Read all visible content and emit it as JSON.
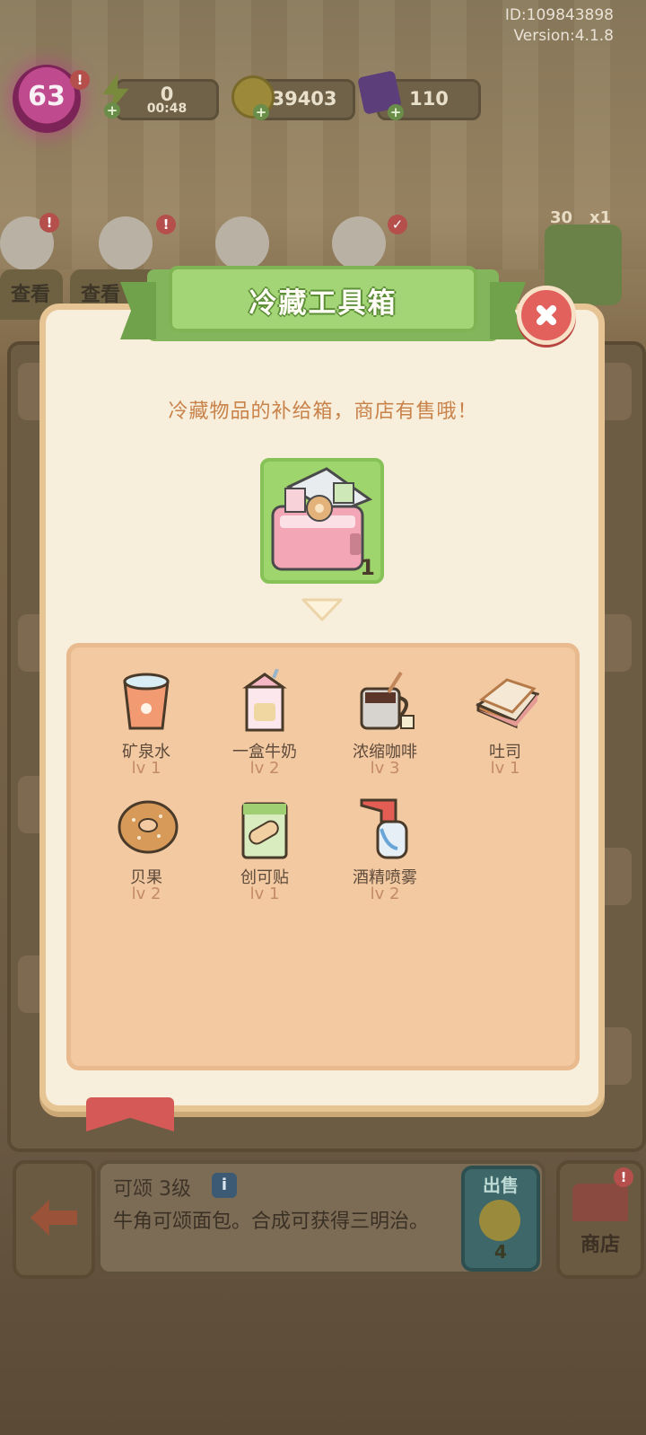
{
  "header": {
    "user_id": "ID:109843898",
    "version": "Version:4.1.8",
    "level": "63",
    "energy": "0",
    "energy_timer": "00:48",
    "coins": "39403",
    "gems": "110",
    "sandwich_bonus": "30",
    "sandwich_multiplier": "x1"
  },
  "background_tabs": {
    "tab1": "查看",
    "tab2": "查看"
  },
  "modal": {
    "title": "冷藏工具箱",
    "subtitle": "冷藏物品的补给箱，商店有售哦！",
    "box_quantity": "1",
    "items": [
      {
        "name": "矿泉水",
        "level": "lv 1",
        "icon": "water-cup-icon"
      },
      {
        "name": "一盒牛奶",
        "level": "lv 2",
        "icon": "milk-carton-icon"
      },
      {
        "name": "浓缩咖啡",
        "level": "lv 3",
        "icon": "coffee-mug-icon"
      },
      {
        "name": "吐司",
        "level": "lv 1",
        "icon": "toast-sandwich-icon"
      },
      {
        "name": "贝果",
        "level": "lv 2",
        "icon": "bagel-icon"
      },
      {
        "name": "创可贴",
        "level": "lv 1",
        "icon": "bandage-icon"
      },
      {
        "name": "酒精喷雾",
        "level": "lv 2",
        "icon": "alcohol-spray-icon"
      }
    ]
  },
  "info": {
    "title": "可颂 3级",
    "description": "牛角可颂面包。合成可获得三明治。",
    "sell_label": "出售",
    "sell_price": "4",
    "shop_label": "商店"
  }
}
